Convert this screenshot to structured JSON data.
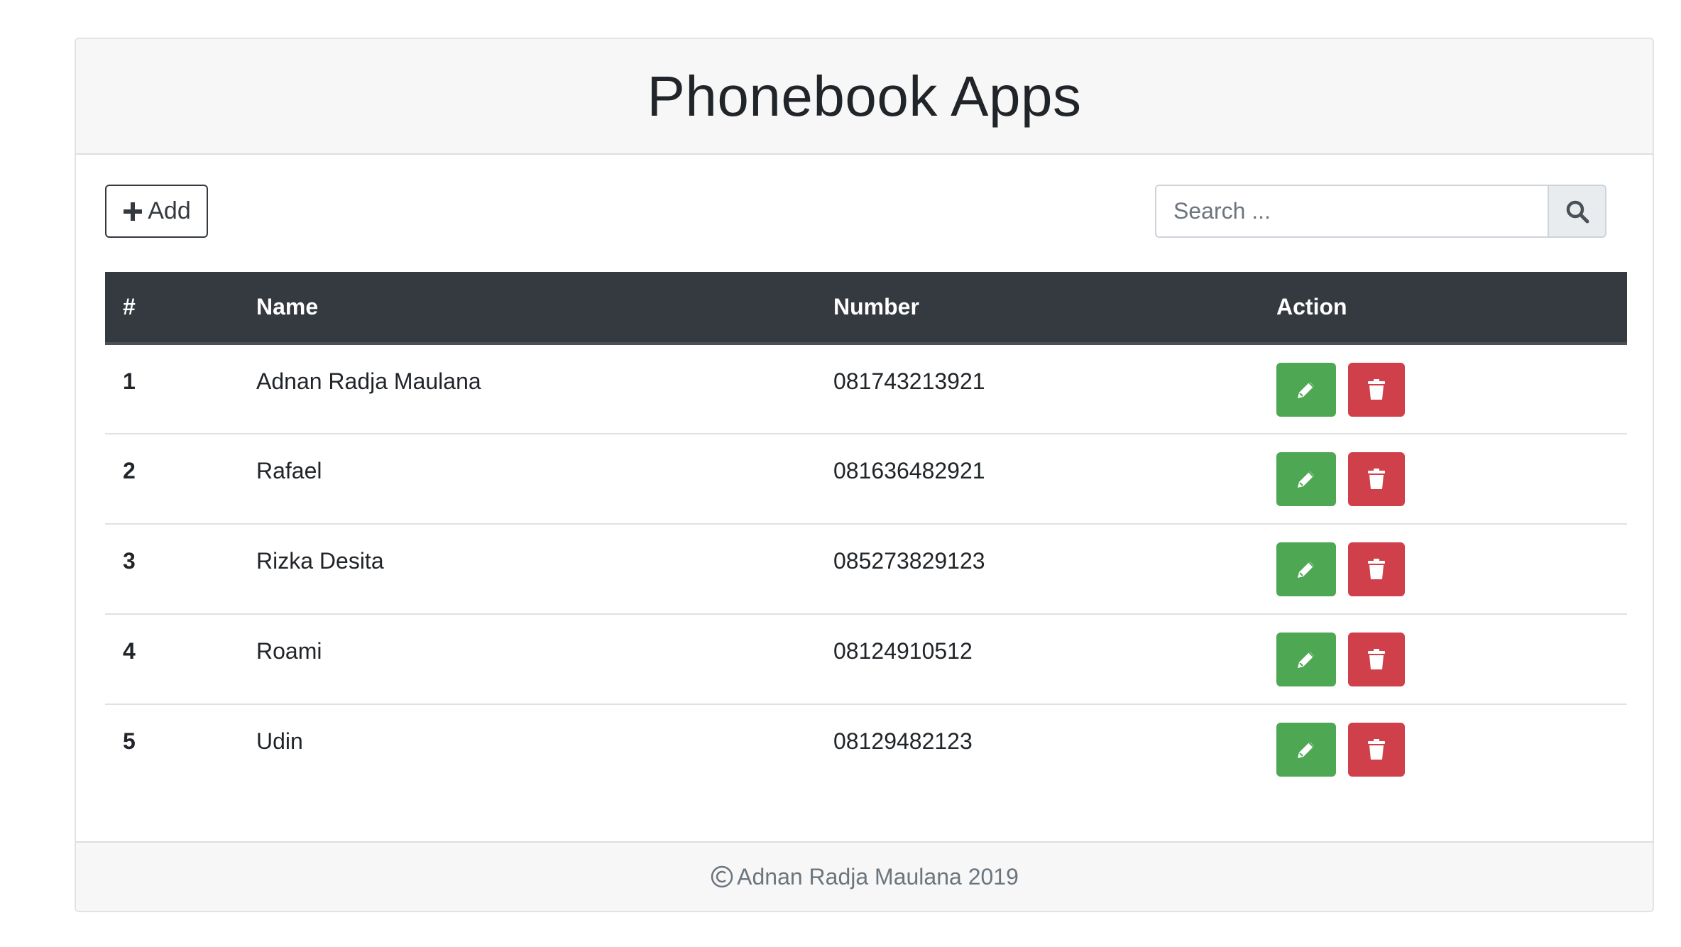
{
  "header": {
    "title": "Phonebook Apps"
  },
  "toolbar": {
    "add_label": "Add",
    "add_icon": "plus-icon",
    "search_placeholder": "Search ...",
    "search_icon": "search-icon"
  },
  "table": {
    "columns": [
      "#",
      "Name",
      "Number",
      "Action"
    ],
    "rows": [
      {
        "index": "1",
        "name": "Adnan Radja Maulana",
        "number": "081743213921"
      },
      {
        "index": "2",
        "name": "Rafael",
        "number": "081636482921"
      },
      {
        "index": "3",
        "name": "Rizka Desita",
        "number": "085273829123"
      },
      {
        "index": "4",
        "name": "Roami",
        "number": "08124910512"
      },
      {
        "index": "5",
        "name": "Udin",
        "number": "08129482123"
      }
    ],
    "edit_icon": "pencil-icon",
    "delete_icon": "trash-icon"
  },
  "footer": {
    "copyright_icon": "copyright-icon",
    "text": "Adnan Radja Maulana 2019"
  },
  "colors": {
    "header_bg": "#343a40",
    "edit_button": "#4ea752",
    "delete_button": "#d0404a"
  }
}
